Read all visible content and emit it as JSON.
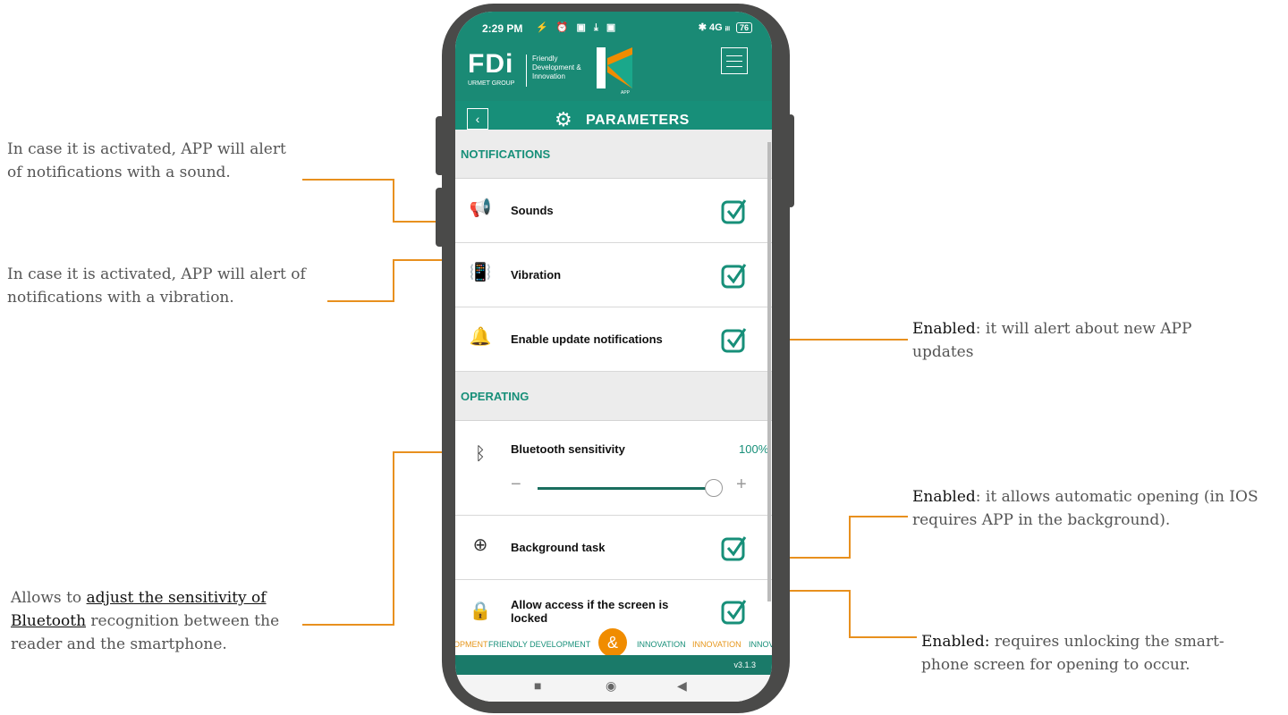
{
  "annotations": {
    "sounds": "In case it is activated, APP will alert of notifications with a sound.",
    "vibration": "In case it is activated, APP will alert of notifications with a vibration.",
    "bluetooth": {
      "prefix": "Allows to ",
      "underlined": "adjust the sensitivity of Bluetooth",
      "suffix": " recognition between the reader and the smartphone."
    },
    "updates": {
      "key": "Enabled",
      "text": ": it will alert about new APP updates"
    },
    "background": {
      "key": "Enabled",
      "text": ": it allows automatic opening (in IOS requires APP in the background)."
    },
    "locked": {
      "key": "Enabled:",
      "text": " requires unlocking the smart-phone screen for opening to occur."
    }
  },
  "status_bar": {
    "time": "2:29 PM",
    "icons": "⚡ ⏰ ▣ ⤓ ▣",
    "right": "✱ 4G ᵢₗₗ",
    "battery": "76"
  },
  "header": {
    "logo": "FDi",
    "logo_sub": "URMET GROUP",
    "tagline": "Friendly Development & Innovation",
    "app_letter": "K",
    "app_sub": "APP"
  },
  "title_bar": {
    "title": "PARAMETERS"
  },
  "notifications": {
    "section": "NOTIFICATIONS",
    "items": [
      {
        "label": "Sounds",
        "checked": true
      },
      {
        "label": "Vibration",
        "checked": true
      },
      {
        "label": "Enable update notifications",
        "checked": true
      }
    ]
  },
  "operating": {
    "section": "OPERATING",
    "bluetooth_label": "Bluetooth sensitivity",
    "bluetooth_value": "100%",
    "slider_minus": "−",
    "slider_plus": "+",
    "slider_level": 1.0,
    "background_label": "Background task",
    "background_checked": true,
    "locked_label": "Allow access if the screen is locked",
    "locked_checked": true
  },
  "ticker": {
    "a": "OPMENT",
    "b": "FRIENDLY DEVELOPMENT",
    "amp": "&",
    "c": "INNOVATION",
    "d": "INNOVATION",
    "e": "INNOV"
  },
  "footer": {
    "version": "v3.1.3"
  },
  "colors": {
    "teal": "#178f79",
    "orange": "#f08c00",
    "annotation_line": "#e8901e"
  }
}
